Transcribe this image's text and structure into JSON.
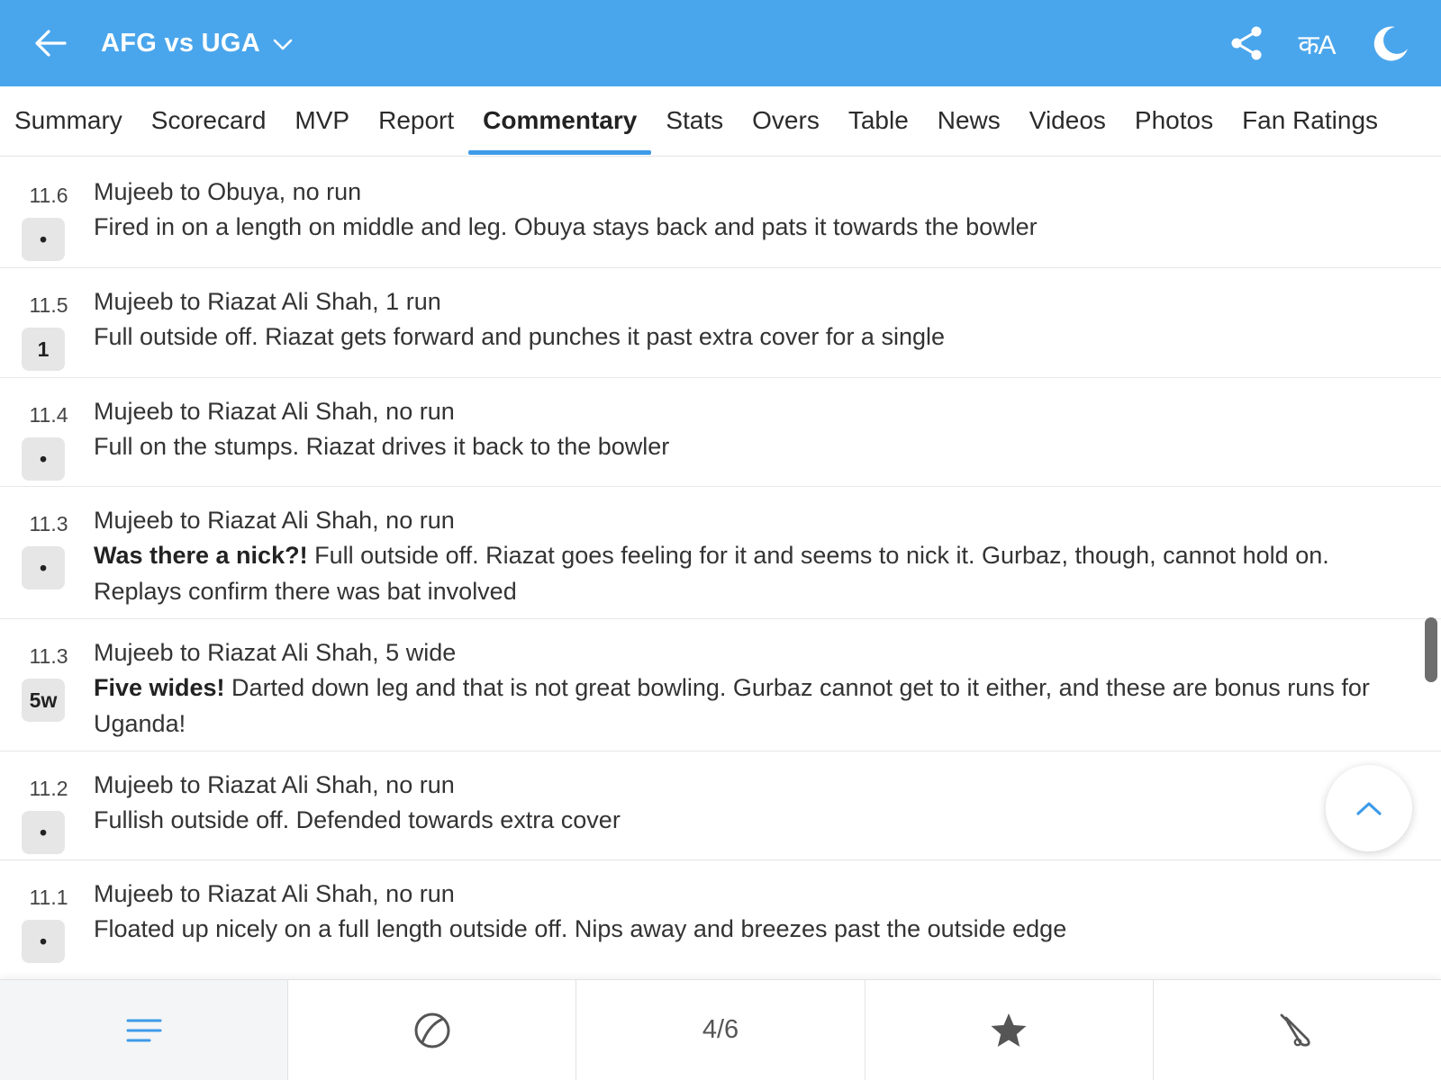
{
  "header": {
    "title": "AFG vs UGA",
    "lang_label": "कA",
    "colors": {
      "bar": "#4aa6ec",
      "accent": "#3d9be9"
    },
    "icons": [
      "back-arrow-icon",
      "chevron-down-icon",
      "share-icon",
      "language-icon",
      "moon-icon"
    ]
  },
  "tabs": [
    {
      "label": "Summary"
    },
    {
      "label": "Scorecard"
    },
    {
      "label": "MVP"
    },
    {
      "label": "Report"
    },
    {
      "label": "Commentary",
      "active": true
    },
    {
      "label": "Stats"
    },
    {
      "label": "Overs"
    },
    {
      "label": "Table"
    },
    {
      "label": "News"
    },
    {
      "label": "Videos"
    },
    {
      "label": "Photos"
    },
    {
      "label": "Fan Ratings"
    }
  ],
  "commentary": [
    {
      "over": "11.6",
      "result": "•",
      "title": "Mujeeb to Obuya, no run",
      "highlight": "",
      "text": "Fired in on a length on middle and leg. Obuya stays back and pats it towards the bowler"
    },
    {
      "over": "11.5",
      "result": "1",
      "title": "Mujeeb to Riazat Ali Shah, 1 run",
      "highlight": "",
      "text": "Full outside off. Riazat gets forward and punches it past extra cover for a single"
    },
    {
      "over": "11.4",
      "result": "•",
      "title": "Mujeeb to Riazat Ali Shah, no run",
      "highlight": "",
      "text": "Full on the stumps. Riazat drives it back to the bowler"
    },
    {
      "over": "11.3",
      "result": "•",
      "title": "Mujeeb to Riazat Ali Shah, no run",
      "highlight": "Was there a nick?!",
      "text": " Full outside off. Riazat goes feeling for it and seems to nick it. Gurbaz, though, cannot hold on. Replays confirm there was bat involved"
    },
    {
      "over": "11.3",
      "result": "5w",
      "title": "Mujeeb to Riazat Ali Shah, 5 wide",
      "highlight": "Five wides!",
      "text": " Darted down leg and that is not great bowling. Gurbaz cannot get to it either, and these are bonus runs for Uganda!"
    },
    {
      "over": "11.2",
      "result": "•",
      "title": "Mujeeb to Riazat Ali Shah, no run",
      "highlight": "",
      "text": "Fullish outside off. Defended towards extra cover"
    },
    {
      "over": "11.1",
      "result": "•",
      "title": "Mujeeb to Riazat Ali Shah, no run",
      "highlight": "",
      "text": "Floated up nicely on a full length outside off. Nips away and breezes past the outside edge"
    }
  ],
  "bottom_bar": {
    "innings_label": "4/6",
    "icons": [
      "menu-lines-icon",
      "ball-icon",
      "star-icon",
      "bat-icon"
    ]
  }
}
